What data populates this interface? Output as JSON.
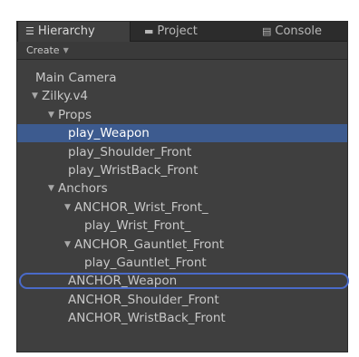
{
  "tabs": [
    {
      "label": "Hierarchy",
      "icon": "list-icon"
    },
    {
      "label": "Project",
      "icon": "folder-icon"
    },
    {
      "label": "Console",
      "icon": "console-icon"
    }
  ],
  "toolbar": {
    "create_label": "Create"
  },
  "tree": [
    {
      "label": "Main Camera",
      "depth": 0,
      "arrow": false
    },
    {
      "label": "Zilky.v4",
      "depth": 0,
      "arrow": true
    },
    {
      "label": "Props",
      "depth": 1,
      "arrow": true
    },
    {
      "label": "play_Weapon",
      "depth": 2,
      "arrow": false,
      "selected": true
    },
    {
      "label": "play_Shoulder_Front",
      "depth": 2,
      "arrow": false
    },
    {
      "label": "play_WristBack_Front",
      "depth": 2,
      "arrow": false
    },
    {
      "label": "Anchors",
      "depth": 1,
      "arrow": true
    },
    {
      "label": "ANCHOR_Wrist_Front_",
      "depth": 2,
      "arrow": true
    },
    {
      "label": "play_Wrist_Front_",
      "depth": 3,
      "arrow": false
    },
    {
      "label": "ANCHOR_Gauntlet_Front",
      "depth": 2,
      "arrow": true
    },
    {
      "label": "play_Gauntlet_Front",
      "depth": 3,
      "arrow": false
    },
    {
      "label": "ANCHOR_Weapon",
      "depth": 2,
      "arrow": false,
      "pinged": true
    },
    {
      "label": "ANCHOR_Shoulder_Front",
      "depth": 2,
      "arrow": false
    },
    {
      "label": "ANCHOR_WristBack_Front",
      "depth": 2,
      "arrow": false
    }
  ]
}
